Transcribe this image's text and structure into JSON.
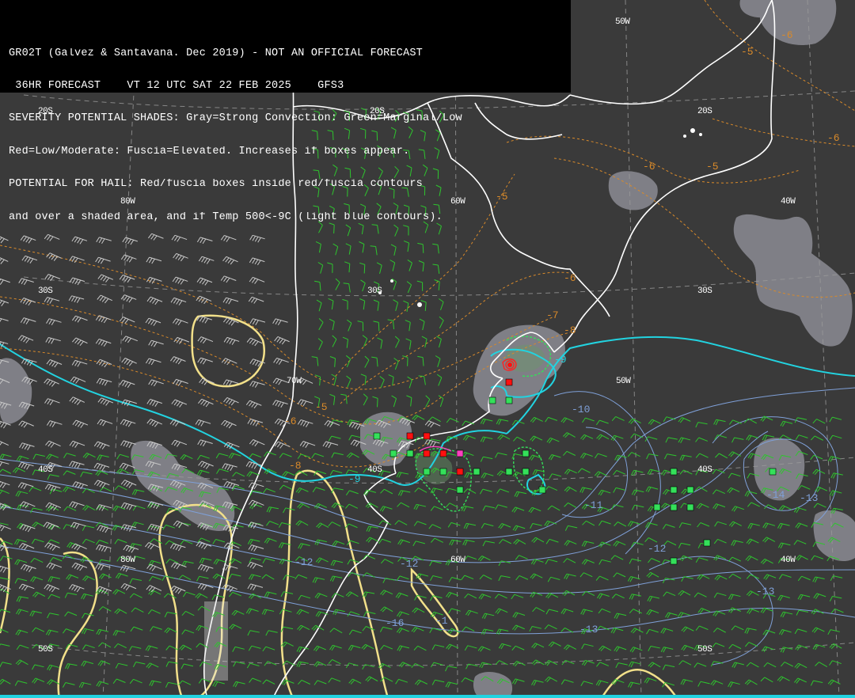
{
  "header": {
    "line1": "GR02T (Galvez & Santavana. Dec 2019) - NOT AN OFFICIAL FORECAST",
    "line2": " 36HR FORECAST    VT 12 UTC SAT 22 FEB 2025    GFS3",
    "line3": "SEVERITY POTENTIAL SHADES: Gray=Strong Convection: Green=Marginal/Low",
    "line4": "Red=Low/Moderate: Fuscia=Elevated. Increases if boxes appear.",
    "line5": "POTENTIAL FOR HAIL: Red/fuscia boxes inside red/fuscia contours",
    "line6": "and over a shaded area, and if Temp 500<-9C (light blue contours)."
  },
  "grid_labels": [
    {
      "text": "20S"
    },
    {
      "text": "20S"
    },
    {
      "text": "20S"
    },
    {
      "text": "50W"
    },
    {
      "text": "80W"
    },
    {
      "text": "60W"
    },
    {
      "text": "40W"
    },
    {
      "text": "30S"
    },
    {
      "text": "30S"
    },
    {
      "text": "30S"
    },
    {
      "text": "70W"
    },
    {
      "text": "50W"
    },
    {
      "text": "40S"
    },
    {
      "text": "40S"
    },
    {
      "text": "40S"
    },
    {
      "text": "80W"
    },
    {
      "text": "60W"
    },
    {
      "text": "40W"
    },
    {
      "text": "50S"
    },
    {
      "text": "50S"
    }
  ],
  "contour_labels": [
    {
      "text": "-6",
      "color": "#d98a2a"
    },
    {
      "text": "-5",
      "color": "#d98a2a"
    },
    {
      "text": "-6",
      "color": "#d98a2a"
    },
    {
      "text": "-6",
      "color": "#d98a2a"
    },
    {
      "text": "-5",
      "color": "#d98a2a"
    },
    {
      "text": "-5",
      "color": "#d98a2a"
    },
    {
      "text": "-6",
      "color": "#d98a2a"
    },
    {
      "text": "-7",
      "color": "#d98a2a"
    },
    {
      "text": "-8",
      "color": "#d98a2a"
    },
    {
      "text": "-5",
      "color": "#d98a2a"
    },
    {
      "text": "-6",
      "color": "#d98a2a"
    },
    {
      "text": "-8",
      "color": "#d98a2a"
    },
    {
      "text": "-9",
      "color": "#22d3e0"
    },
    {
      "text": "-9",
      "color": "#22d3e0"
    },
    {
      "text": "-10",
      "color": "#7fa0d8"
    },
    {
      "text": "-11",
      "color": "#7fa0d8"
    },
    {
      "text": "-12",
      "color": "#7fa0d8"
    },
    {
      "text": "-12",
      "color": "#7fa0d8"
    },
    {
      "text": "-13",
      "color": "#7fa0d8"
    },
    {
      "text": "-13",
      "color": "#7fa0d8"
    },
    {
      "text": "-14",
      "color": "#7fa0d8"
    },
    {
      "text": "-13",
      "color": "#7fa0d8"
    },
    {
      "text": "-16",
      "color": "#7fa0d8"
    },
    {
      "text": "-12",
      "color": "#7fa0d8"
    },
    {
      "text": "-1",
      "color": "#7fa0d8"
    }
  ],
  "colors": {
    "background": "#3a3a3a",
    "coast": "#ffffff",
    "grid": "#9a9a9a",
    "temp_minus9": "#22d3e0",
    "temp_contours": "#7fa0d8",
    "orange_contours": "#d98a2a",
    "yellow_contours": "#f2e08a",
    "gray_shade": "#8c8c94",
    "green_box": "#34e05a",
    "red_box": "#ff1010",
    "fuscia_box": "#ff40c0",
    "wind_barbs": "#2ec52e"
  },
  "boxes": {
    "green_count": 32,
    "red_count": 8,
    "fuscia_count": 1
  }
}
